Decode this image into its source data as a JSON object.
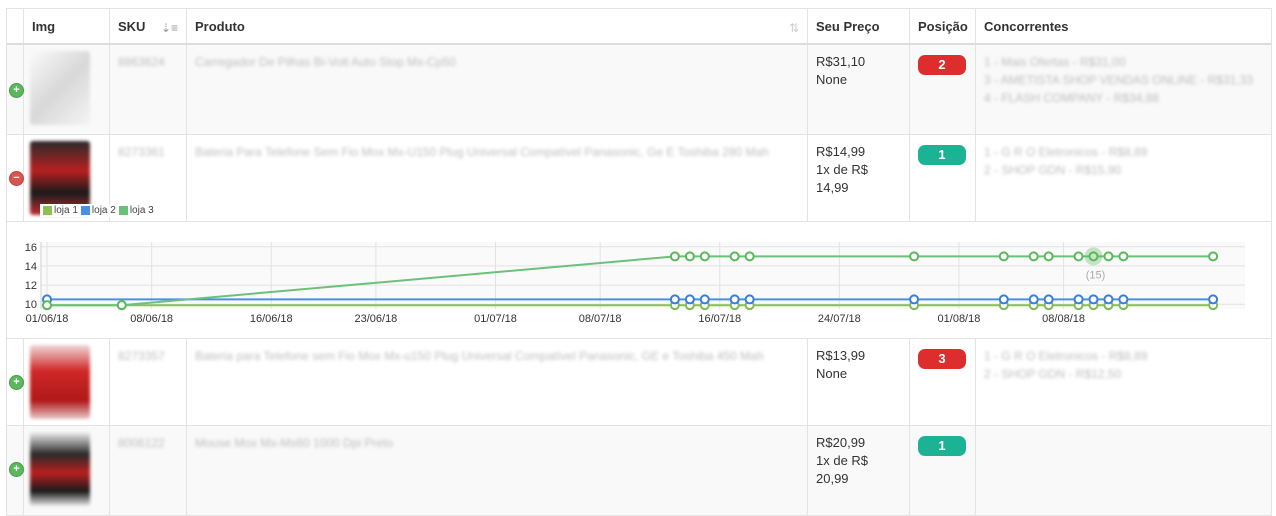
{
  "table": {
    "headers": {
      "img": "Img",
      "sku": "SKU",
      "produto": "Produto",
      "preco": "Seu Preço",
      "posicao": "Posição",
      "concorrentes": "Concorrentes"
    },
    "rows": [
      {
        "sku": "8863624",
        "produto": "Carregador De Pilhas Bi-Volt Auto Stop Mx-Cp50",
        "price_line1": "R$31,10",
        "price_line2": "None",
        "price_line3": "",
        "position": "2",
        "position_color": "#dd2d2d",
        "competitors": [
          "1 - Mais Ofertas - R$31,00",
          "3 - AMETISTA SHOP VENDAS ONLINE - R$31,33",
          "4 - FLASH COMPANY - R$34,88"
        ],
        "toggle": "+"
      },
      {
        "sku": "8273361",
        "produto": "Bateria Para Telefone Sem Fio Mox Mx-U150 Plug Universal Compatível Panasonic, Ge E Toshiba 280 Mah",
        "price_line1": "R$14,99",
        "price_line2": "1x de R$",
        "price_line3": "14,99",
        "position": "1",
        "position_color": "#1bb394",
        "competitors": [
          "1 - G R O Eletronicos - R$8,89",
          "2 - SHOP GDN - R$15,90"
        ],
        "toggle": "−"
      },
      {
        "sku": "8273357",
        "produto": "Bateria para Telefone sem Fio Mox Mx-u150 Plug Universal Compatível Panasonic, GE e Toshiba 450 Mah",
        "price_line1": "R$13,99",
        "price_line2": "None",
        "price_line3": "",
        "position": "3",
        "position_color": "#dd2d2d",
        "competitors": [
          "1 - G R O Eletronicos - R$8,89",
          "2 - SHOP GDN - R$12,50"
        ],
        "toggle": "+"
      },
      {
        "sku": "8006122",
        "produto": "Mouse Mox Mx-Ms60 1000 Dpi Preto",
        "price_line1": "R$20,99",
        "price_line2": "1x de R$",
        "price_line3": "20,99",
        "position": "1",
        "position_color": "#1bb394",
        "competitors": [],
        "toggle": "+"
      }
    ]
  },
  "chart_data": {
    "type": "line",
    "title": "",
    "xlabel": "",
    "ylabel": "",
    "x_tick_labels": [
      "01/06/18",
      "08/06/18",
      "16/06/18",
      "23/06/18",
      "01/07/18",
      "08/07/18",
      "16/07/18",
      "24/07/18",
      "01/08/18",
      "08/08/18"
    ],
    "x_tick_dates": [
      "2018-06-01",
      "2018-06-08",
      "2018-06-16",
      "2018-06-23",
      "2018-07-01",
      "2018-07-08",
      "2018-07-16",
      "2018-07-24",
      "2018-08-01",
      "2018-08-08"
    ],
    "y_ticks": [
      10,
      12,
      14,
      16
    ],
    "ylim": [
      9.5,
      16.5
    ],
    "xlim": [
      "2018-06-01",
      "2018-08-20"
    ],
    "grid": true,
    "tooltip_label": "(15)",
    "series": [
      {
        "name": "loja 1",
        "color": "#8cc152",
        "marker_color": "#7dbb55",
        "points": [
          [
            "2018-06-01",
            9.9
          ],
          [
            "2018-06-06",
            9.9
          ],
          [
            "2018-07-13",
            9.9
          ],
          [
            "2018-07-14",
            9.9
          ],
          [
            "2018-07-15",
            9.9
          ],
          [
            "2018-07-17",
            9.9
          ],
          [
            "2018-07-18",
            9.9
          ],
          [
            "2018-07-29",
            9.9
          ],
          [
            "2018-08-04",
            9.9
          ],
          [
            "2018-08-06",
            9.9
          ],
          [
            "2018-08-07",
            9.9
          ],
          [
            "2018-08-09",
            9.9
          ],
          [
            "2018-08-10",
            9.9
          ],
          [
            "2018-08-11",
            9.9
          ],
          [
            "2018-08-12",
            9.9
          ],
          [
            "2018-08-18",
            9.9
          ]
        ]
      },
      {
        "name": "loja 2",
        "color": "#4a90e2",
        "marker_color": "#3b7dd8",
        "points": [
          [
            "2018-06-01",
            10.5
          ],
          [
            "2018-07-13",
            10.5
          ],
          [
            "2018-07-14",
            10.5
          ],
          [
            "2018-07-15",
            10.5
          ],
          [
            "2018-07-17",
            10.5
          ],
          [
            "2018-07-18",
            10.5
          ],
          [
            "2018-07-29",
            10.5
          ],
          [
            "2018-08-04",
            10.5
          ],
          [
            "2018-08-06",
            10.5
          ],
          [
            "2018-08-07",
            10.5
          ],
          [
            "2018-08-09",
            10.5
          ],
          [
            "2018-08-10",
            10.5
          ],
          [
            "2018-08-11",
            10.5
          ],
          [
            "2018-08-12",
            10.5
          ],
          [
            "2018-08-18",
            10.5
          ]
        ]
      },
      {
        "name": "loja 3",
        "color": "#6cc17a",
        "marker_color": "#5cb85c",
        "points": [
          [
            "2018-06-01",
            9.9
          ],
          [
            "2018-06-06",
            9.9
          ],
          [
            "2018-07-13",
            15
          ],
          [
            "2018-07-14",
            15
          ],
          [
            "2018-07-15",
            15
          ],
          [
            "2018-07-17",
            15
          ],
          [
            "2018-07-18",
            15
          ],
          [
            "2018-07-29",
            15
          ],
          [
            "2018-08-04",
            15
          ],
          [
            "2018-08-06",
            15
          ],
          [
            "2018-08-07",
            15
          ],
          [
            "2018-08-09",
            15
          ],
          [
            "2018-08-10",
            15
          ],
          [
            "2018-08-11",
            15
          ],
          [
            "2018-08-12",
            15
          ],
          [
            "2018-08-18",
            15
          ]
        ]
      }
    ]
  }
}
